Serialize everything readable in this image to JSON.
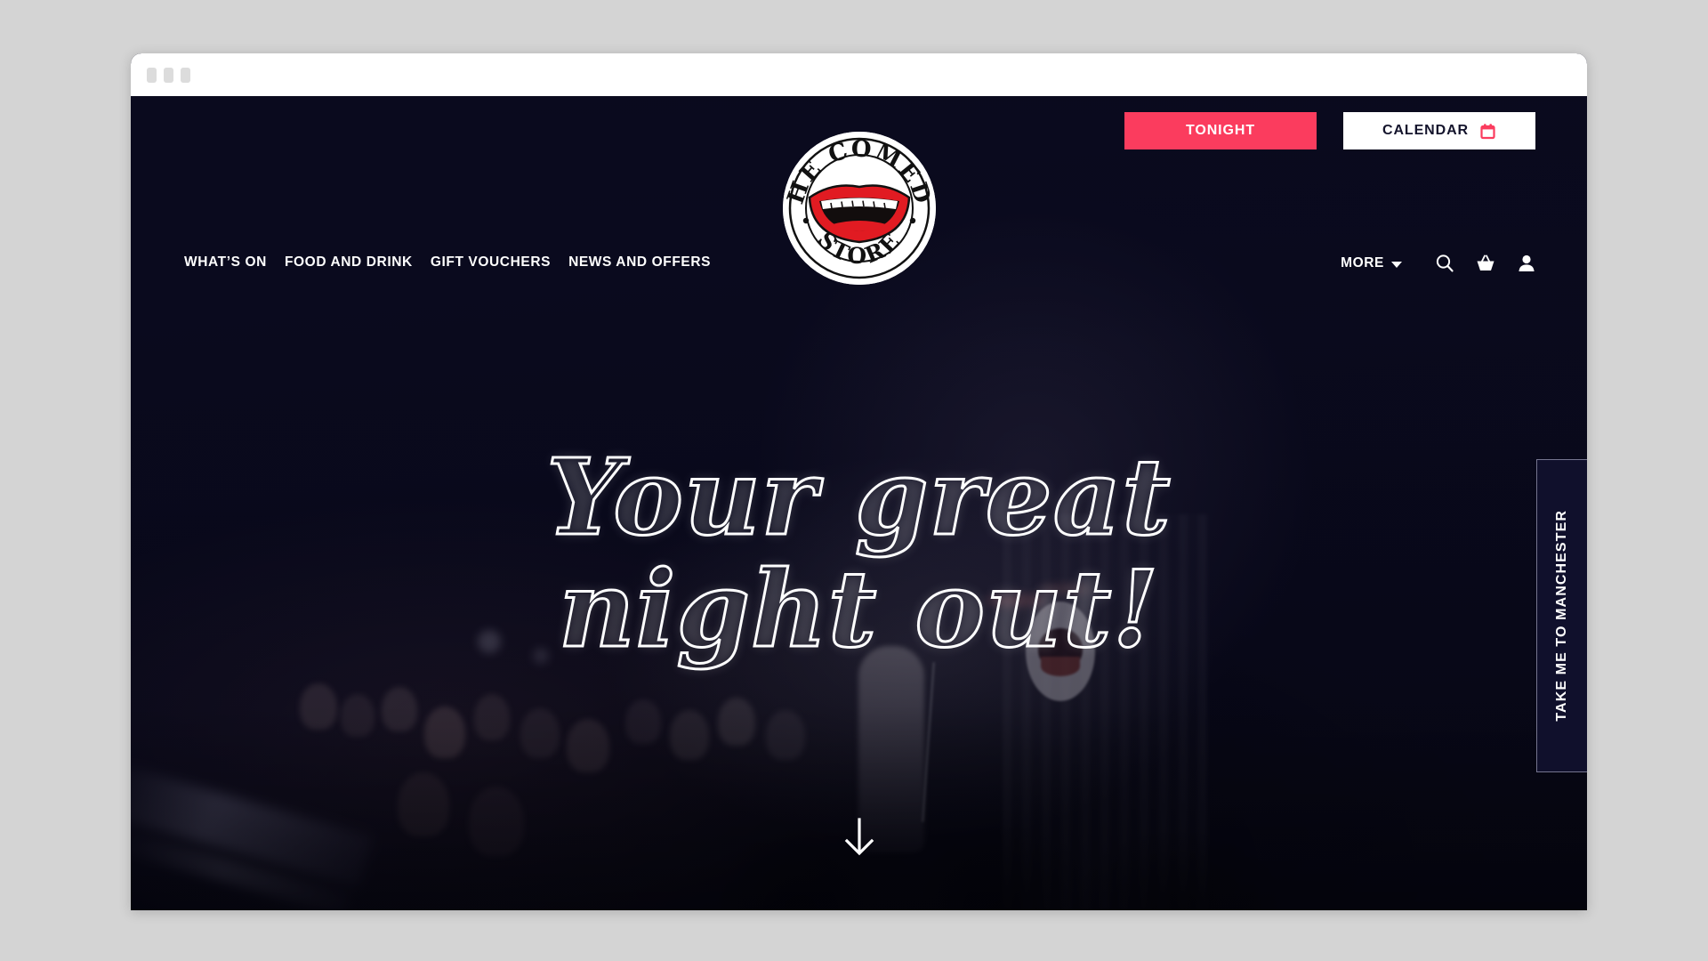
{
  "window": {
    "dots": [
      "dot-1",
      "dot-2",
      "dot-3"
    ]
  },
  "colors": {
    "accent_pink": "#FB3C5E",
    "page_background": "#0A0A20",
    "desktop_background": "#D4D4D4",
    "text_white": "#FFFFFF",
    "logo_red": "#E11B22"
  },
  "header": {
    "top_buttons": [
      {
        "label": "TONIGHT",
        "style": "filled-pink",
        "icon": null
      },
      {
        "label": "CALENDAR",
        "style": "filled-white",
        "icon": "calendar-icon"
      }
    ],
    "nav_links": [
      {
        "label": "WHAT’S ON"
      },
      {
        "label": "FOOD AND DRINK"
      },
      {
        "label": "GIFT VOUCHERS"
      },
      {
        "label": "NEWS AND OFFERS"
      }
    ],
    "more_menu": {
      "label": "MORE",
      "icon": "chevron-down-icon"
    },
    "icons": [
      {
        "name": "search-icon"
      },
      {
        "name": "basket-icon"
      },
      {
        "name": "account-icon"
      }
    ],
    "logo": {
      "alt": "The Comedy Store",
      "text_top": "THE COMEDY",
      "text_bottom": "STORE"
    }
  },
  "hero": {
    "headline_line_1": "Your great",
    "headline_line_2": "night out!",
    "scroll_indicator": "scroll-down-arrow",
    "background_description": "comedy club stage with performer and audience"
  },
  "side_tab": {
    "label": "TAKE ME TO MANCHESTER"
  }
}
